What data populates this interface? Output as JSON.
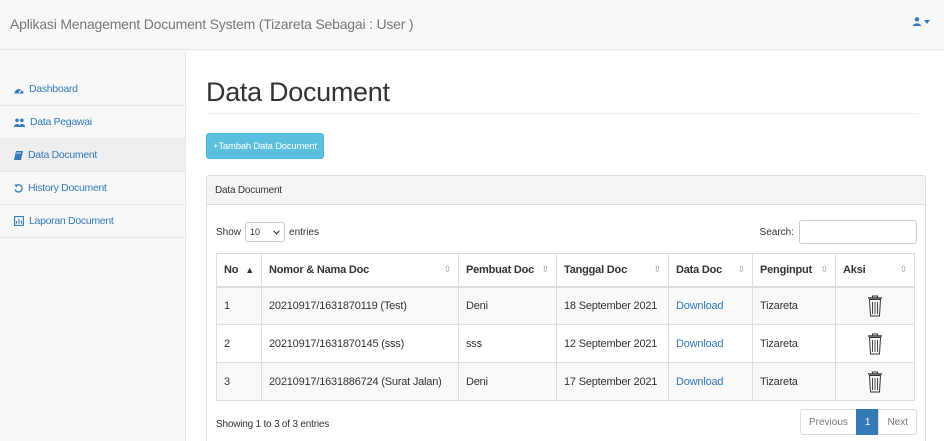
{
  "app": {
    "title": "Aplikasi Menagement Document System (Tizareta Sebagai : User )"
  },
  "sidebar": {
    "items": [
      {
        "label": "Dashboard",
        "icon": "dashboard-icon"
      },
      {
        "label": "Data Pegawai",
        "icon": "users-icon"
      },
      {
        "label": "Data Document",
        "icon": "book-icon",
        "active": true
      },
      {
        "label": "History Document",
        "icon": "history-icon"
      },
      {
        "label": "Laporan Document",
        "icon": "report-icon"
      }
    ]
  },
  "main": {
    "page_title": "Data Document",
    "add_button_label": "+Tambah Data Document",
    "panel_title": "Data Document",
    "length": {
      "show_label": "Show",
      "value": "10",
      "entries_label": "entries"
    },
    "search_label": "Search:",
    "table": {
      "headers": [
        "No",
        "Nomor & Nama Doc",
        "Pembuat Doc",
        "Tanggal Doc",
        "Data Doc",
        "Penginput",
        "Aksi"
      ],
      "rows": [
        {
          "no": "1",
          "nomor": "20210917/1631870119 (Test)",
          "pembuat": "Deni",
          "tanggal": "18 September 2021",
          "data": "Download",
          "penginput": "Tizareta"
        },
        {
          "no": "2",
          "nomor": "20210917/1631870145 (sss)",
          "pembuat": "sss",
          "tanggal": "12 September 2021",
          "data": "Download",
          "penginput": "Tizareta"
        },
        {
          "no": "3",
          "nomor": "20210917/1631886724 (Surat Jalan)",
          "pembuat": "Deni",
          "tanggal": "17 September 2021",
          "data": "Download",
          "penginput": "Tizareta"
        }
      ]
    },
    "info": "Showing 1 to 3 of 3 entries",
    "pagination": {
      "previous": "Previous",
      "current": "1",
      "next": "Next"
    }
  },
  "colors": {
    "link": "#337ab7",
    "info_button": "#5bc0de",
    "active_page": "#337ab7"
  }
}
